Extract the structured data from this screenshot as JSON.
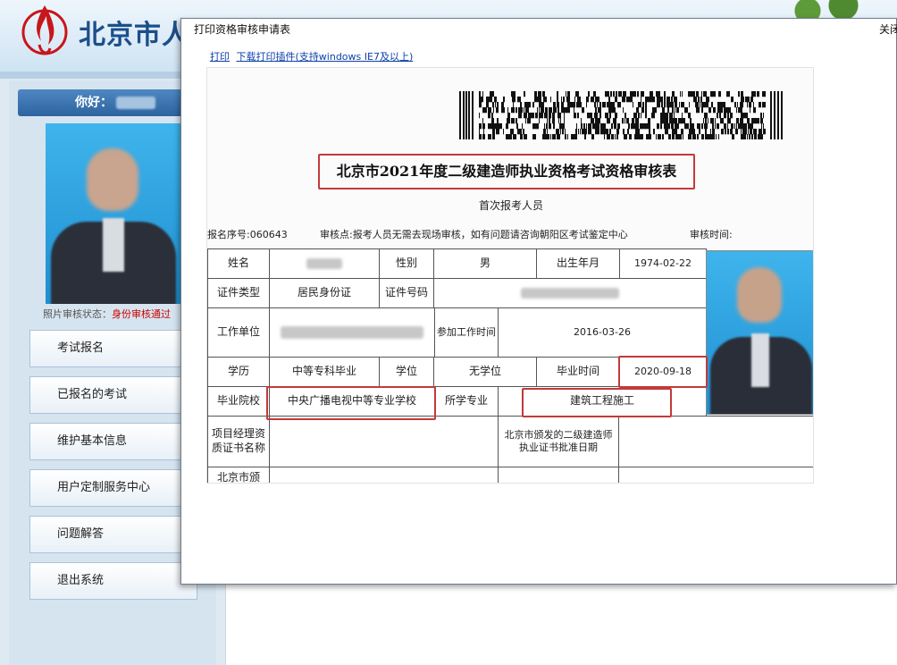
{
  "site": {
    "title": "北京市人"
  },
  "sidebar": {
    "greeting": "你好：",
    "photo_status_label": "照片审核状态：",
    "photo_status_value": "身份审核通过",
    "nav": [
      {
        "label": "考试报名"
      },
      {
        "label": "已报名的考试"
      },
      {
        "label": "维护基本信息"
      },
      {
        "label": "用户定制服务中心"
      },
      {
        "label": "问题解答"
      },
      {
        "label": "退出系统"
      }
    ]
  },
  "dialog": {
    "title": "打印资格审核申请表",
    "close_label": "关闭",
    "print_link": "打印",
    "download_link": "下载打印插件(支持windows IE7及以上)"
  },
  "document": {
    "title": "北京市2021年度二级建造师执业资格考试资格审核表",
    "subtitle": "首次报考人员",
    "reg_no": "报名序号:060643",
    "review_point": "审核点:报考人员无需去现场审核，如有问题请咨询朝阳区考试鉴定中心",
    "review_time": "审核时间:",
    "labels": {
      "name": "姓名",
      "gender": "性别",
      "birth": "出生年月",
      "id_type": "证件类型",
      "id_no": "证件号码",
      "work_unit": "工作单位",
      "work_start": "参加工作时间",
      "education": "学历",
      "degree": "学位",
      "grad_time": "毕业时间",
      "school": "毕业院校",
      "major": "所学专业",
      "pm_cert": "项目经理资质证书名称",
      "bj_cert": "北京市颁发的二级建造师执业证书批准日期",
      "bj_row": "北京市颁"
    },
    "values": {
      "gender": "男",
      "birth": "1974-02-22",
      "id_type": "居民身份证",
      "work_start": "2016-03-26",
      "education": "中等专科毕业",
      "degree": "无学位",
      "grad_time": "2020-09-18",
      "school": "中央广播电视中等专业学校",
      "major": "建筑工程施工"
    }
  }
}
